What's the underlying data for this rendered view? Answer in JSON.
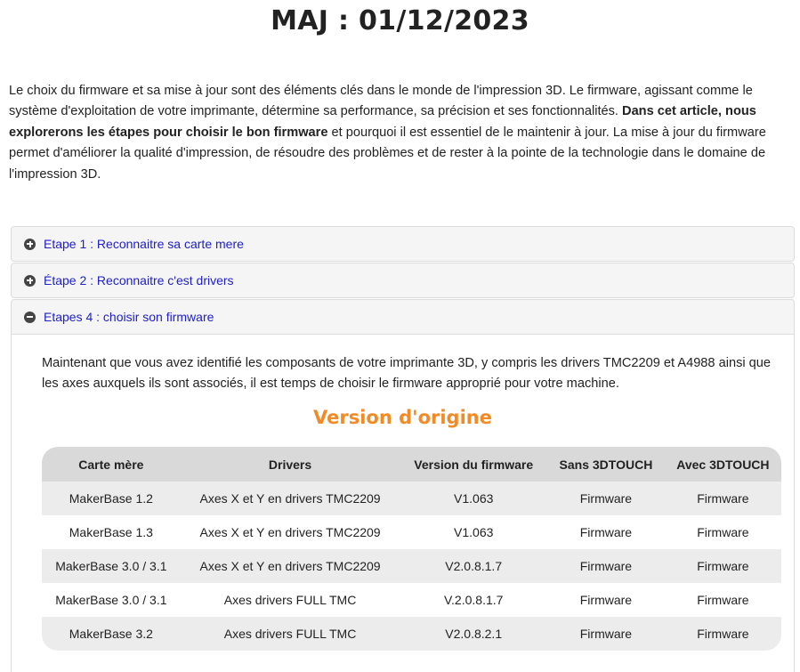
{
  "header": {
    "title": "MAJ : 01/12/2023"
  },
  "intro": {
    "part1": "Le choix du firmware et sa mise à jour sont des éléments clés dans le monde de l'impression 3D. Le firmware, agissant comme le système d'exploitation de votre imprimante, détermine sa performance, sa précision et ses fonctionnalités. ",
    "bold": "Dans cet article, nous explorerons les étapes pour choisir le bon firmware",
    "part2": " et pourquoi il est essentiel de le maintenir à jour. La mise à jour du firmware permet d'améliorer la qualité d'impression, de résoudre des problèmes et de rester à la pointe de la technologie dans le domaine de l'impression 3D."
  },
  "accordion": {
    "items": [
      {
        "label": "Etape 1 : Reconnaitre sa carte mere",
        "icon": "plus-circle-icon",
        "expanded": false
      },
      {
        "label": "Étape 2 : Reconnaitre c'est drivers",
        "icon": "plus-circle-icon",
        "expanded": false
      },
      {
        "label": "Etapes 4 : choisir son firmware",
        "icon": "minus-circle-icon",
        "expanded": true
      }
    ]
  },
  "firmware": {
    "intro": "Maintenant que vous avez identifié les composants de votre imprimante 3D, y compris les drivers TMC2209 et A4988 ainsi que les axes auxquels ils sont associés, il est temps de choisir le firmware approprié pour votre machine.",
    "section_title": "Version d'origine",
    "headers": [
      "Carte mère",
      "Drivers",
      "Version du firmware",
      "Sans 3DTOUCH",
      "Avec 3DTOUCH"
    ],
    "rows": [
      {
        "board": "MakerBase 1.2",
        "drivers": "Axes X et Y en drivers TMC2209",
        "version": "V1.063",
        "without": "Firmware",
        "with": "Firmware"
      },
      {
        "board": "MakerBase 1.3",
        "drivers": "Axes X et Y en drivers TMC2209",
        "version": "V1.063",
        "without": "Firmware",
        "with": "Firmware"
      },
      {
        "board": "MakerBase 3.0 / 3.1",
        "drivers": "Axes X et Y en drivers TMC2209",
        "version": "V2.0.8.1.7",
        "without": "Firmware",
        "with": "Firmware"
      },
      {
        "board": "MakerBase 3.0 / 3.1",
        "drivers": "Axes drivers FULL TMC",
        "version": "V.2.0.8.1.7",
        "without": "Firmware",
        "with": "Firmware"
      },
      {
        "board": "MakerBase 3.2",
        "drivers": "Axes drivers FULL TMC",
        "version": "V2.0.8.2.1",
        "without": "Firmware",
        "with": "Firmware"
      }
    ]
  },
  "colors": {
    "link": "#1f20c9",
    "section_title": "#f28a25",
    "table_header": "#d9d9d9",
    "table_stripe": "#ececec",
    "accordion_bg": "#f5f5f5"
  }
}
